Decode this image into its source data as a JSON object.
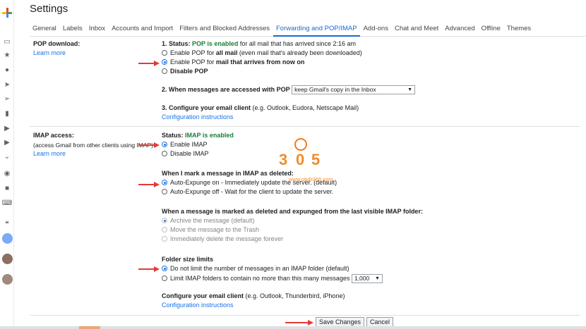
{
  "page_title": "Settings",
  "tabs": [
    "General",
    "Labels",
    "Inbox",
    "Accounts and Import",
    "Filters and Blocked Addresses",
    "Forwarding and POP/IMAP",
    "Add-ons",
    "Chat and Meet",
    "Advanced",
    "Offline",
    "Themes"
  ],
  "active_tab": "Forwarding and POP/IMAP",
  "pop": {
    "label": "POP download:",
    "learn_more": "Learn more",
    "status_prefix": "1. Status: ",
    "status_value": "POP is enabled",
    "status_suffix": " for all mail that has arrived since 2:16 am",
    "opt1_prefix": "Enable POP for ",
    "opt1_bold": "all mail",
    "opt1_suffix": " (even mail that's already been downloaded)",
    "opt2_prefix": "Enable POP for ",
    "opt2_bold": "mail that arrives from now on",
    "opt3": "Disable POP",
    "step2_label": "2. When messages are accessed with POP",
    "step2_select": "keep Gmail's copy in the Inbox",
    "step3_label": "3. Configure your email client",
    "step3_hint": " (e.g. Outlook, Eudora, Netscape Mail)",
    "config_link": "Configuration instructions"
  },
  "imap": {
    "label": "IMAP access:",
    "sublabel": "(access Gmail from other clients using IMAP)",
    "learn_more": "Learn more",
    "status_prefix": "Status: ",
    "status_value": "IMAP is enabled",
    "enable": "Enable IMAP",
    "disable": "Disable IMAP",
    "deleted_heading": "When I mark a message in IMAP as deleted:",
    "expunge_on": "Auto-Expunge on - Immediately update the server. (default)",
    "expunge_off": "Auto-Expunge off - Wait for the client to update the server.",
    "expunged_heading": "When a message is marked as deleted and expunged from the last visible IMAP folder:",
    "archive": "Archive the message (default)",
    "trash": "Move the message to the Trash",
    "delete_forever": "Immediately delete the message forever",
    "folder_heading": "Folder size limits",
    "no_limit": "Do not limit the number of messages in an IMAP folder (default)",
    "limit": "Limit IMAP folders to contain no more than this many messages",
    "limit_select": "1,000",
    "config_heading": "Configure your email client",
    "config_hint": " (e.g. Outlook, Thunderbird, iPhone)",
    "config_link": "Configuration instructions"
  },
  "buttons": {
    "save": "Save Changes",
    "cancel": "Cancel"
  },
  "watermark": {
    "digits_left": "3",
    "digits_right": "5",
    "site": "www.obdii365.com"
  },
  "colors": {
    "accent": "#1a73e8",
    "status_green": "#188038",
    "arrow_red": "#e53935",
    "watermark_orange": "#f28c28"
  }
}
